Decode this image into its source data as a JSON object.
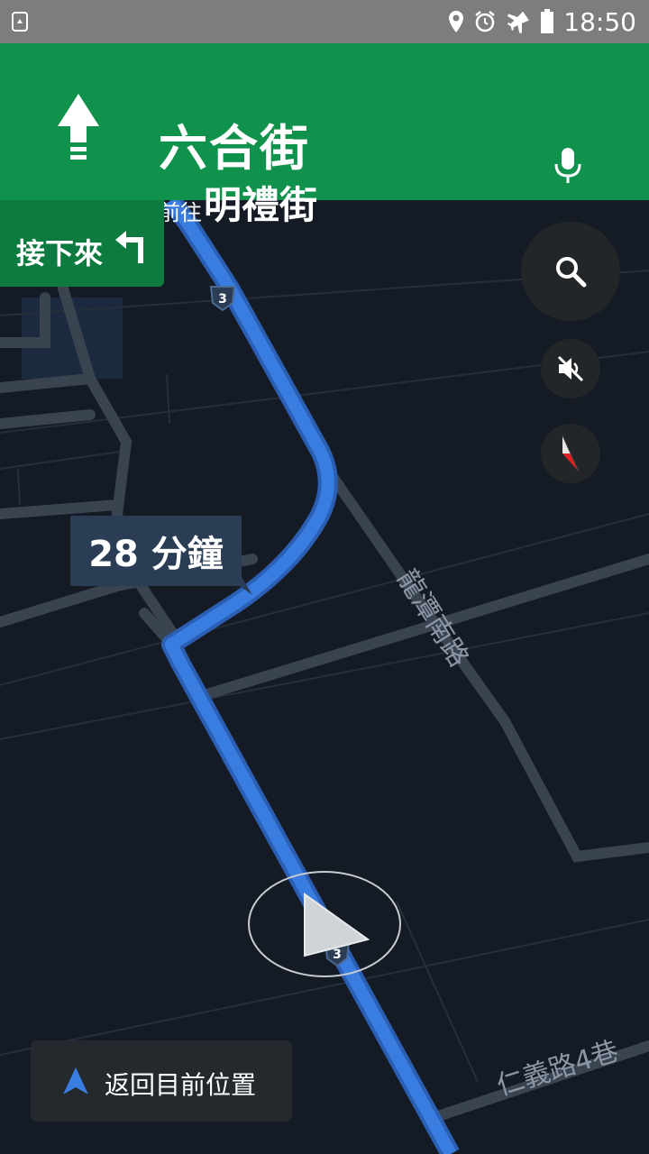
{
  "status_bar": {
    "time": "18:50",
    "icons": [
      "recycle-icon",
      "location-pin-icon",
      "alarm-icon",
      "airplane-mode-icon",
      "battery-icon"
    ]
  },
  "navigation": {
    "current_street": "六合街",
    "toward_prefix": "前往",
    "toward_street": "明禮街",
    "maneuver_icon": "straight-arrow-icon",
    "mic_icon": "microphone-icon",
    "banner_color": "#10924c"
  },
  "next_step": {
    "label": "接下來",
    "icon": "turn-left-icon"
  },
  "map": {
    "eta_label": "28 分鐘",
    "road_labels": {
      "longtan_south_road": "龍潭南路",
      "renyi_lane": "仁義路4巷"
    },
    "route_shields": [
      "3",
      "3"
    ],
    "route_color": "#3a7de0"
  },
  "controls": {
    "search_icon": "search-icon",
    "mute_icon": "sound-muted-icon",
    "compass_icon": "compass-icon"
  },
  "recenter": {
    "label": "返回目前位置",
    "icon": "navigation-arrow-icon"
  }
}
